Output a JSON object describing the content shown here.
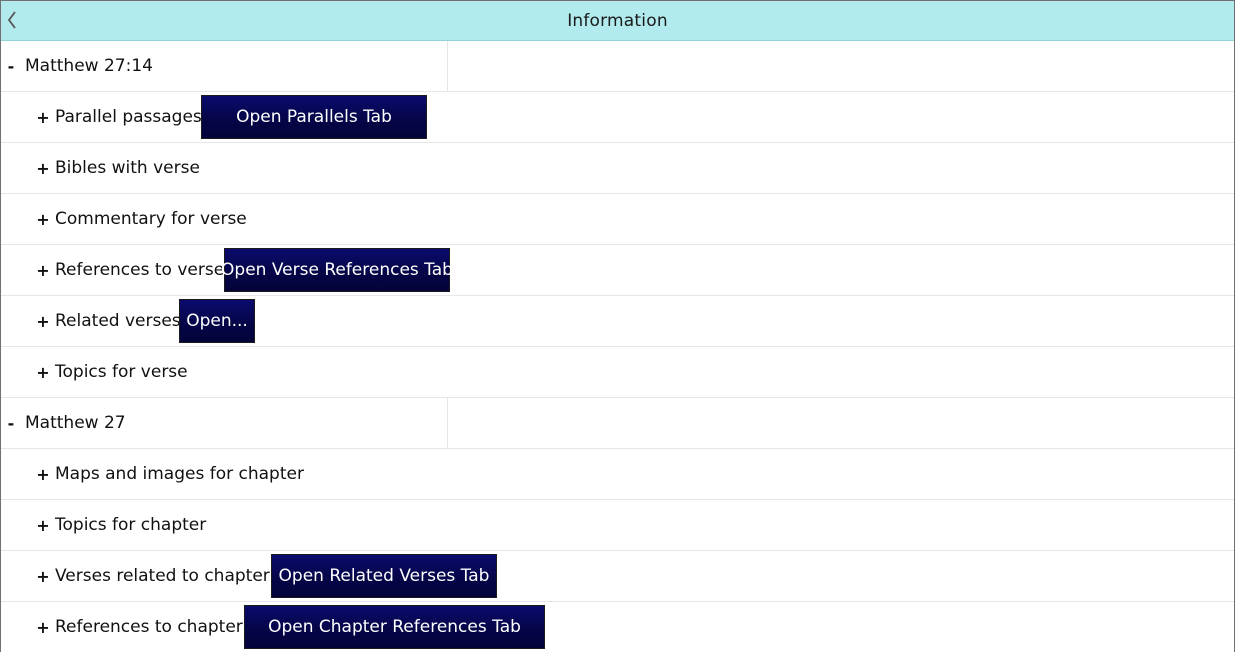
{
  "window": {
    "title": "Information"
  },
  "icons": {
    "back": "chevron-left-icon"
  },
  "colors": {
    "header": "#b2ebed",
    "button": "#06064f",
    "button_text": "#ffffff"
  },
  "tree": {
    "verse_section": {
      "toggle": "-",
      "label": "Matthew 27:14",
      "items": [
        {
          "toggle": "+",
          "label": "Parallel passages",
          "button": "Open Parallels Tab"
        },
        {
          "toggle": "+",
          "label": "Bibles with verse"
        },
        {
          "toggle": "+",
          "label": "Commentary for verse"
        },
        {
          "toggle": "+",
          "label": "References to verse",
          "button": "Open Verse References Tab"
        },
        {
          "toggle": "+",
          "label": "Related verses",
          "button": "Open..."
        },
        {
          "toggle": "+",
          "label": "Topics for verse"
        }
      ]
    },
    "chapter_section": {
      "toggle": "-",
      "label": "Matthew 27",
      "items": [
        {
          "toggle": "+",
          "label": "Maps and images for chapter"
        },
        {
          "toggle": "+",
          "label": "Topics for chapter"
        },
        {
          "toggle": "+",
          "label": "Verses related to chapter",
          "button": "Open Related Verses Tab"
        },
        {
          "toggle": "+",
          "label": "References to chapter",
          "button": "Open Chapter References Tab"
        }
      ]
    }
  }
}
